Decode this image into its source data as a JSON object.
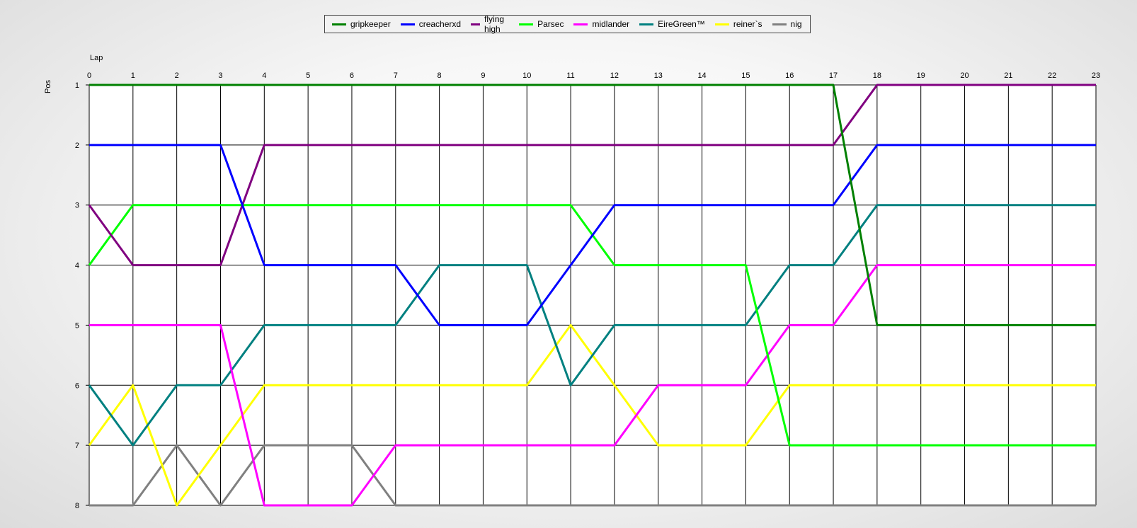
{
  "chart_data": {
    "type": "line",
    "xlabel": "Lap",
    "ylabel": "Pos",
    "x": [
      0,
      1,
      2,
      3,
      4,
      5,
      6,
      7,
      8,
      9,
      10,
      11,
      12,
      13,
      14,
      15,
      16,
      17,
      18,
      19,
      20,
      21,
      22,
      23
    ],
    "xlim": [
      0,
      23
    ],
    "ylim": [
      1,
      8
    ],
    "y_inverted": true,
    "grid": true,
    "legend_position": "top-center",
    "series": [
      {
        "name": "gripkeeper",
        "color": "#008000",
        "values": [
          1,
          1,
          1,
          1,
          1,
          1,
          1,
          1,
          1,
          1,
          1,
          1,
          1,
          1,
          1,
          1,
          1,
          1,
          5,
          5,
          5,
          5,
          5,
          5
        ]
      },
      {
        "name": "creacherxd",
        "color": "#0000ff",
        "values": [
          2,
          2,
          2,
          2,
          4,
          4,
          4,
          4,
          5,
          5,
          5,
          4,
          3,
          3,
          3,
          3,
          3,
          3,
          2,
          2,
          2,
          2,
          2,
          2
        ]
      },
      {
        "name": "flying high",
        "color": "#800080",
        "values": [
          3,
          4,
          4,
          4,
          2,
          2,
          2,
          2,
          2,
          2,
          2,
          2,
          2,
          2,
          2,
          2,
          2,
          2,
          1,
          1,
          1,
          1,
          1,
          1
        ]
      },
      {
        "name": "Parsec",
        "color": "#00ff00",
        "values": [
          4,
          3,
          3,
          3,
          3,
          3,
          3,
          3,
          3,
          3,
          3,
          3,
          4,
          4,
          4,
          4,
          7,
          7,
          7,
          7,
          7,
          7,
          7,
          7
        ]
      },
      {
        "name": "midlander",
        "color": "#ff00ff",
        "values": [
          5,
          5,
          5,
          5,
          8,
          8,
          8,
          7,
          7,
          7,
          7,
          7,
          7,
          6,
          6,
          6,
          5,
          5,
          4,
          4,
          4,
          4,
          4,
          4
        ]
      },
      {
        "name": "EireGreen™",
        "color": "#008080",
        "values": [
          6,
          7,
          6,
          6,
          5,
          5,
          5,
          5,
          4,
          4,
          4,
          6,
          5,
          5,
          5,
          5,
          4,
          4,
          3,
          3,
          3,
          3,
          3,
          3
        ]
      },
      {
        "name": "reiner`s",
        "color": "#ffff00",
        "values": [
          7,
          6,
          8,
          7,
          6,
          6,
          6,
          6,
          6,
          6,
          6,
          5,
          6,
          7,
          7,
          7,
          6,
          6,
          6,
          6,
          6,
          6,
          6,
          6
        ]
      },
      {
        "name": "nig",
        "color": "#808080",
        "values": [
          8,
          8,
          7,
          8,
          7,
          7,
          7,
          8,
          8,
          8,
          8,
          8,
          8,
          8,
          8,
          8,
          8,
          8,
          8,
          8,
          8,
          8,
          8,
          8
        ]
      }
    ]
  }
}
